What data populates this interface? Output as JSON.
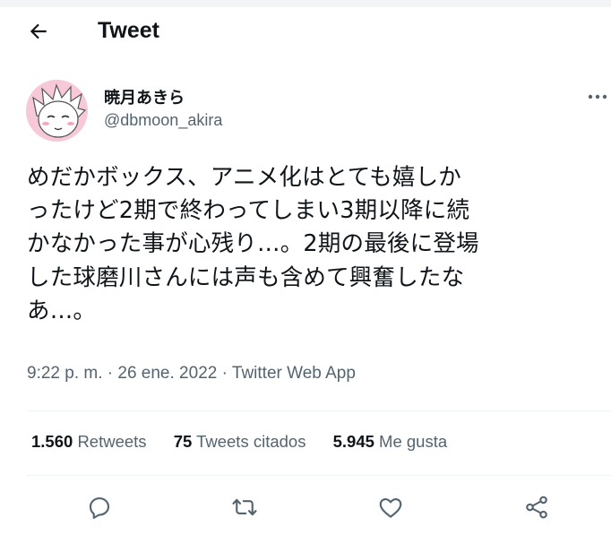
{
  "header": {
    "title": "Tweet",
    "back_icon": "arrow-left-icon"
  },
  "author": {
    "display_name": "暁月あきら",
    "handle": "@dbmoon_akira",
    "avatar": "anime-character-avatar"
  },
  "tweet": {
    "text": "めだかボックス、アニメ化はとても嬉しか\nったけど2期で終わってしまい3期以降に続\nかなかった事が心残り…。2期の最後に登場\nした球磨川さんには声も含めて興奮したな\nあ…。",
    "time": "9:22 p. m.",
    "date": "26 ene. 2022",
    "source": "Twitter Web App"
  },
  "stats": {
    "retweets_count": "1.560",
    "retweets_label": "Retweets",
    "quotes_count": "75",
    "quotes_label": "Tweets citados",
    "likes_count": "5.945",
    "likes_label": "Me gusta"
  },
  "actions": [
    "reply-icon",
    "retweet-icon",
    "like-icon",
    "share-icon"
  ],
  "colors": {
    "text": "#0f1419",
    "secondary": "#536471",
    "divider": "#eff3f4",
    "avatar_bg": "#f6c8d8"
  }
}
